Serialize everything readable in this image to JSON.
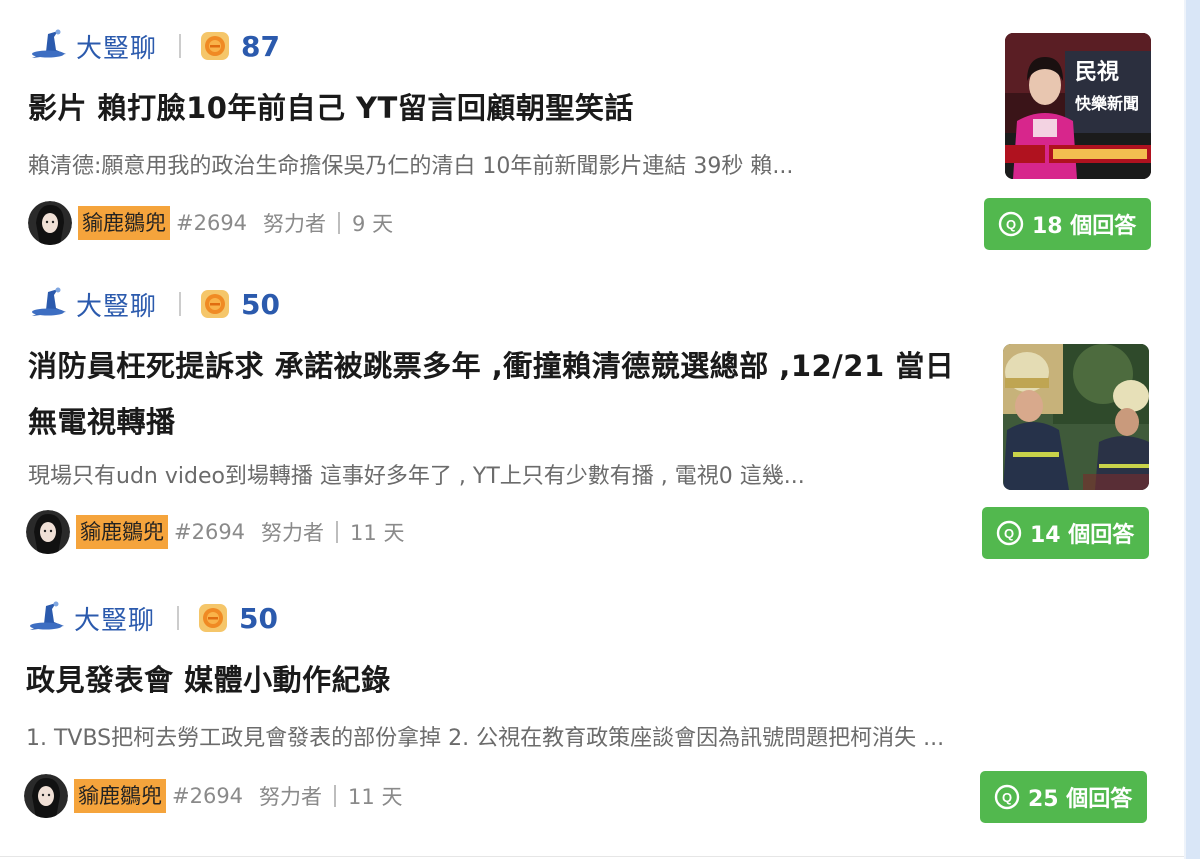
{
  "posts": [
    {
      "board": "大豎聊",
      "coins": "87",
      "title": "影片 賴打臉10年前自己 YT留言回顧朝聖笑話",
      "excerpt": "賴清德:願意用我的政治生命擔保吳乃仁的清白 10年前新聞影片連結 39秒 賴...",
      "author": "貐鹿鶵兜",
      "author_id": "#2694",
      "rank": "努力者",
      "age": "9 天",
      "answers": "18 個回答",
      "thumb_text": [
        "民視",
        "快樂新聞"
      ]
    },
    {
      "board": "大豎聊",
      "coins": "50",
      "title": "消防員枉死提訴求 承諾被跳票多年 ,衝撞賴清德競選總部 ,12/21 當日無電視轉播",
      "excerpt": "現場只有udn video到場轉播 這事好多年了 , YT上只有少數有播 , 電視0 這幾...",
      "author": "貐鹿鶵兜",
      "author_id": "#2694",
      "rank": "努力者",
      "age": "11 天",
      "answers": "14 個回答"
    },
    {
      "board": "大豎聊",
      "coins": "50",
      "title": "政見發表會 媒體小動作紀錄",
      "excerpt": "1. TVBS把柯去勞工政見會發表的部份拿掉 2. 公視在教育政策座談會因為訊號問題把柯消失 ...",
      "author": "貐鹿鶵兜",
      "author_id": "#2694",
      "rank": "努力者",
      "age": "11 天",
      "answers": "25 個回答"
    }
  ],
  "colors": {
    "board_blue": "#2b5aad",
    "answer_green": "#52b84e",
    "author_tag": "#f5a43c"
  },
  "icons": {
    "board": "witch-hat-icon",
    "coin": "coin-icon",
    "answers": "q-bubble-icon"
  }
}
